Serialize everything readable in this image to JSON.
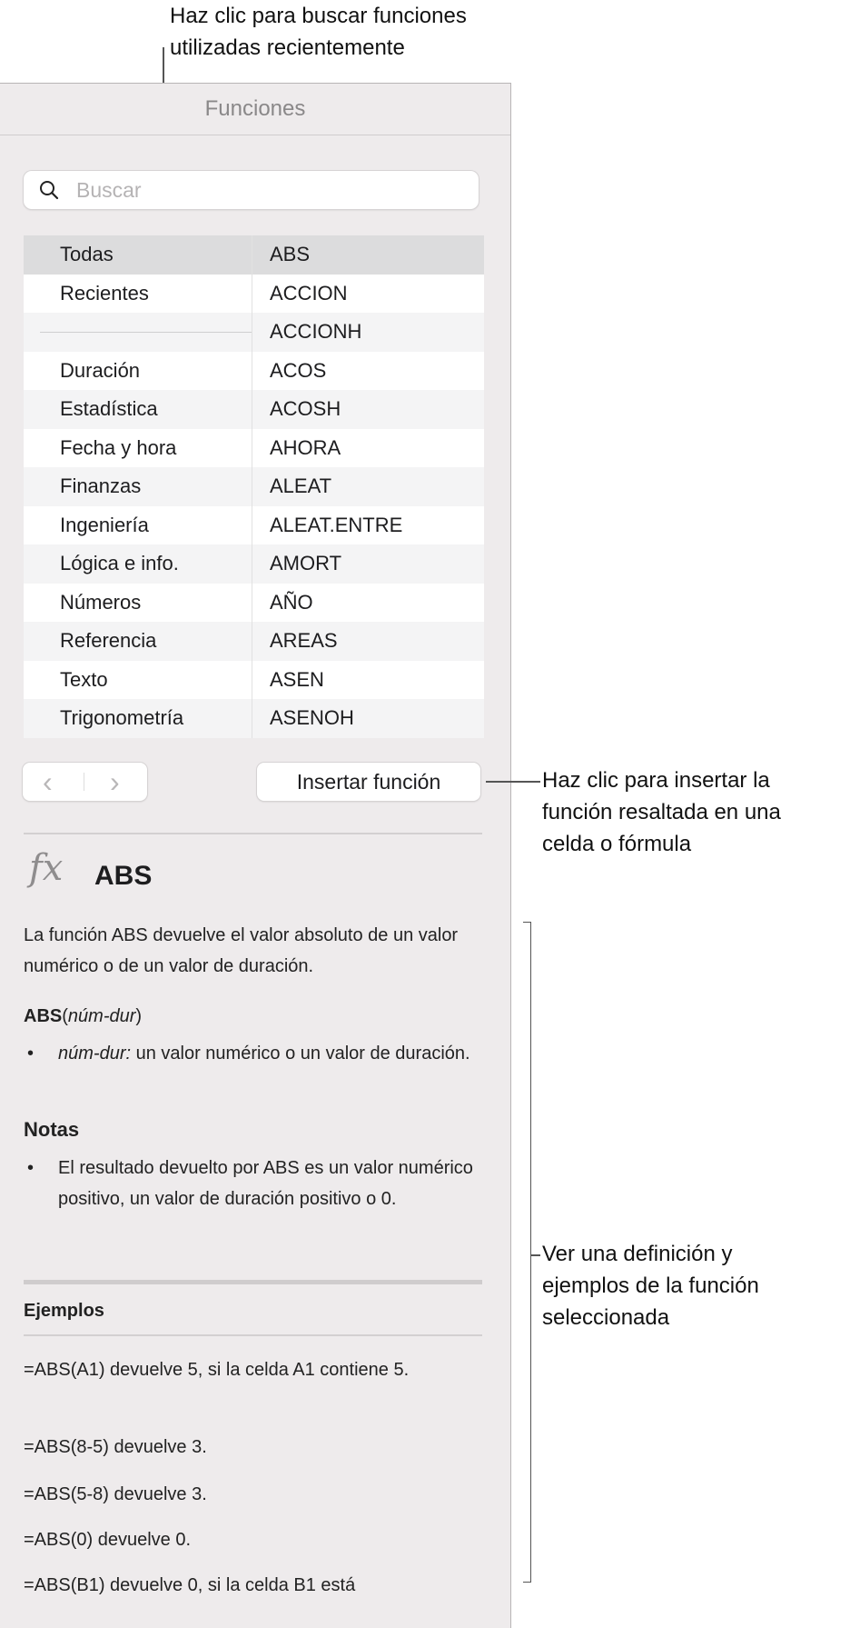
{
  "callouts": {
    "recent": [
      "Haz clic para buscar funciones",
      "utilizadas recientemente"
    ],
    "insert": [
      "Haz clic para insertar la",
      "función resaltada en una",
      "celda o fórmula"
    ],
    "definition": [
      "Ver una definición y",
      "ejemplos de la función",
      "seleccionada"
    ]
  },
  "panel": {
    "title": "Funciones",
    "search": {
      "placeholder": "Buscar",
      "icon": "search-icon"
    },
    "categories": [
      "Todas",
      "Recientes",
      "",
      "Duración",
      "Estadística",
      "Fecha y hora",
      "Finanzas",
      "Ingeniería",
      "Lógica e info.",
      "Números",
      "Referencia",
      "Texto",
      "Trigonometría"
    ],
    "functions": [
      "ABS",
      "ACCION",
      "ACCIONH",
      "ACOS",
      "ACOSH",
      "AHORA",
      "ALEAT",
      "ALEAT.ENTRE",
      "AMORT",
      "AÑO",
      "AREAS",
      "ASEN",
      "ASENOH"
    ],
    "nav": {
      "back": "‹",
      "forward": "›"
    },
    "insert_button": "Insertar función",
    "detail": {
      "fx": "fx",
      "name": "ABS",
      "description": "La función ABS devuelve el valor absoluto de un valor numérico o de un valor de duración.",
      "syntax_name": "ABS",
      "syntax_arg": "núm-dur",
      "arg_name": "núm-dur:",
      "arg_desc": " un valor numérico o un valor de duración.",
      "notes_heading": "Notas",
      "note": "El resultado devuelto por ABS es un valor numérico positivo, un valor de duración positivo o 0.",
      "examples_heading": "Ejemplos",
      "examples": [
        "=ABS(A1) devuelve 5, si la celda A1 contiene 5.",
        "=ABS(8-5) devuelve 3.",
        "=ABS(5-8) devuelve 3.",
        "=ABS(0) devuelve 0.",
        "=ABS(B1) devuelve 0, si la celda B1 está"
      ]
    }
  }
}
